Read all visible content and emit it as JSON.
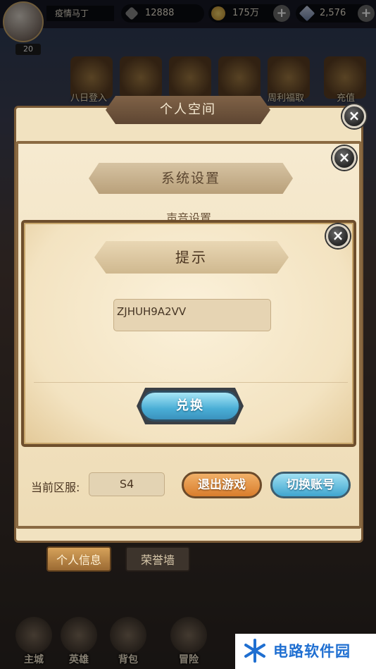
{
  "topbar": {
    "player_name": "疫情马丁",
    "power": "12888",
    "gold": "175万",
    "gems": "2,576",
    "level": "20"
  },
  "activities": [
    {
      "label": "八日登入"
    },
    {
      "label": ""
    },
    {
      "label": ""
    },
    {
      "label": "周利福取"
    },
    {
      "label": ""
    },
    {
      "label": "充值"
    }
  ],
  "panel_profile": {
    "title": "个人空间",
    "tabs": [
      "个人信息",
      "荣誉墙"
    ]
  },
  "panel_settings": {
    "title": "系统设置",
    "subheading": "声音设置",
    "server_label": "当前区服:",
    "server_value": "S4",
    "exit_label": "退出游戏",
    "switch_label": "切换账号"
  },
  "dialog": {
    "title": "提示",
    "code_value": "ZJHUH9A2VV",
    "redeem_label": "兑换"
  },
  "bottom_nav": [
    {
      "label": "主城"
    },
    {
      "label": "英雄"
    },
    {
      "label": "背包"
    },
    {
      "label": "冒险"
    }
  ],
  "watermark": {
    "text": "电路软件园"
  },
  "colors": {
    "parchment": "#f3e3c1",
    "frame": "#6e4e2c",
    "blue_button": "#4aaed6",
    "orange_button": "#d97d2c"
  }
}
